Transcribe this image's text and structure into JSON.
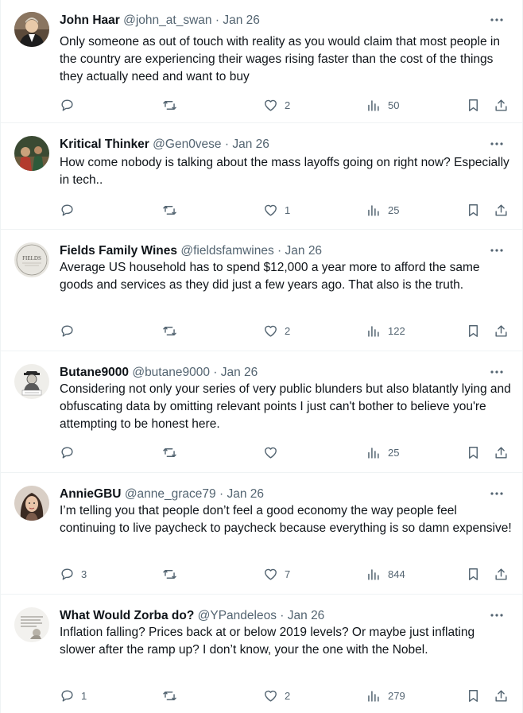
{
  "tweets": [
    {
      "name": "John Haar",
      "handle": "@john_at_swan",
      "date": "Jan 26",
      "text": "Only someone as out of touch with reality as you would claim that most people in the country are experiencing their wages rising faster than the cost of the things they actually need and want to buy",
      "replies": "",
      "reposts": "",
      "likes": "2",
      "views": "50"
    },
    {
      "name": "Kritical Thinker",
      "handle": "@Gen0vese",
      "date": "Jan 26",
      "text": "How come nobody is talking about the mass layoffs going on right now? Especially in tech..",
      "replies": "",
      "reposts": "",
      "likes": "1",
      "views": "25"
    },
    {
      "name": "Fields Family Wines",
      "handle": "@fieldsfamwines",
      "date": "Jan 26",
      "text": "Average US household has to spend $12,000 a year more to afford the same goods and services as they did just a few years ago. That also is the truth.",
      "replies": "",
      "reposts": "",
      "likes": "2",
      "views": "122",
      "avatar_text": "FIELDS"
    },
    {
      "name": "Butane9000",
      "handle": "@butane9000",
      "date": "Jan 26",
      "text": "Considering not only your series of very public blunders but also blatantly lying and obfuscating data by omitting relevant points I just can't bother to believe you're attempting to be honest here.",
      "replies": "",
      "reposts": "",
      "likes": "",
      "views": "25"
    },
    {
      "name": "AnnieGBU",
      "handle": "@anne_grace79",
      "date": "Jan 26",
      "text": "I’m telling you that people don’t feel a good economy the way people feel continuing to live paycheck to paycheck because everything is so damn expensive!",
      "replies": "3",
      "reposts": "",
      "likes": "7",
      "views": "844"
    },
    {
      "name": "What Would Zorba do?",
      "handle": "@YPandeleos",
      "date": "Jan 26",
      "text": "Inflation falling? Prices back at or below 2019 levels? Or maybe just inflating slower after the ramp up? I don’t know, your the one with the Nobel.",
      "replies": "1",
      "reposts": "",
      "likes": "2",
      "views": "279"
    }
  ],
  "separator": "·",
  "icons": [
    "reply-icon",
    "repost-icon",
    "like-icon",
    "views-icon",
    "bookmark-icon",
    "share-icon",
    "more-icon"
  ],
  "colors": {
    "text": "#0f1419",
    "secondary": "#536471",
    "divider": "#eff3f4"
  }
}
